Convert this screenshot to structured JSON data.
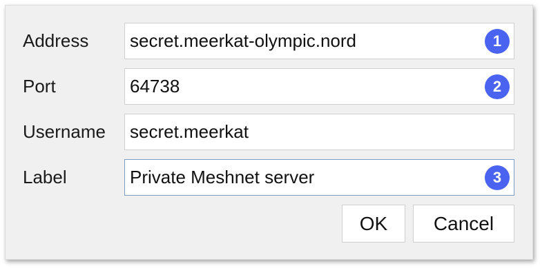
{
  "form": {
    "fields": [
      {
        "label": "Address",
        "value": "secret.meerkat-olympic.nord",
        "badge": "1"
      },
      {
        "label": "Port",
        "value": "64738",
        "badge": "2"
      },
      {
        "label": "Username",
        "value": "secret.meerkat",
        "badge": ""
      },
      {
        "label": "Label",
        "value": "Private Meshnet server",
        "badge": "3"
      }
    ]
  },
  "buttons": {
    "ok_label": "OK",
    "cancel_label": "Cancel"
  },
  "colors": {
    "badge": "#4a63f0",
    "dialog_background": "#f0f0f0",
    "focus_border": "#7a9cc6"
  }
}
